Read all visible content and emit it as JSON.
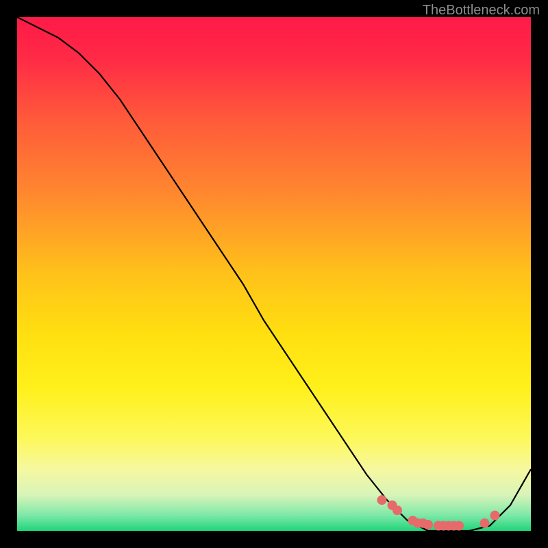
{
  "watermark": "TheBottleneck.com",
  "chart_data": {
    "type": "line",
    "title": "",
    "xlabel": "",
    "ylabel": "",
    "xlim": [
      0,
      100
    ],
    "ylim": [
      0,
      100
    ],
    "series": [
      {
        "name": "curve",
        "x": [
          0,
          4,
          8,
          12,
          16,
          20,
          24,
          28,
          32,
          36,
          40,
          44,
          48,
          52,
          56,
          60,
          64,
          68,
          72,
          76,
          80,
          84,
          88,
          92,
          96,
          100
        ],
        "values": [
          100,
          98,
          96,
          93,
          89,
          84,
          78,
          72,
          66,
          60,
          54,
          48,
          41,
          35,
          29,
          23,
          17,
          11,
          6,
          2,
          0,
          0,
          0,
          1,
          5,
          12
        ]
      }
    ],
    "markers": {
      "name": "points",
      "x": [
        71,
        73,
        74,
        77,
        78,
        79,
        80,
        82,
        83,
        84,
        85,
        86,
        91,
        93
      ],
      "values": [
        6,
        5,
        4,
        2,
        1.5,
        1.5,
        1.2,
        1,
        1,
        1,
        1,
        1,
        1.5,
        3
      ],
      "color": "#e76a6a",
      "radius": 7
    },
    "background": {
      "type": "vertical-gradient",
      "stops": [
        {
          "offset": 0,
          "color": "#ff1a47"
        },
        {
          "offset": 0.08,
          "color": "#ff2a46"
        },
        {
          "offset": 0.2,
          "color": "#ff5a3a"
        },
        {
          "offset": 0.35,
          "color": "#ff8a2e"
        },
        {
          "offset": 0.5,
          "color": "#ffc21a"
        },
        {
          "offset": 0.62,
          "color": "#ffe010"
        },
        {
          "offset": 0.72,
          "color": "#fff01a"
        },
        {
          "offset": 0.82,
          "color": "#fdf85a"
        },
        {
          "offset": 0.88,
          "color": "#f6f8a0"
        },
        {
          "offset": 0.93,
          "color": "#d8f4b8"
        },
        {
          "offset": 0.97,
          "color": "#7de8a8"
        },
        {
          "offset": 1.0,
          "color": "#1fd47a"
        }
      ]
    }
  }
}
